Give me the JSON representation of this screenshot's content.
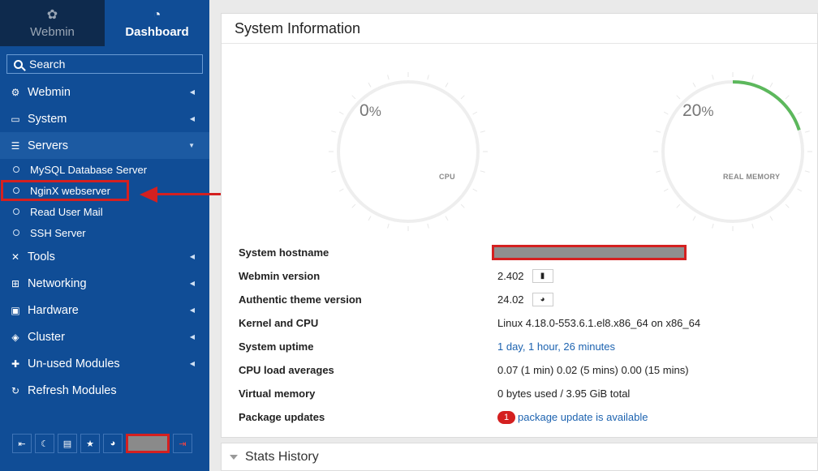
{
  "sidebar": {
    "tabs": [
      {
        "label": "Webmin",
        "icon": "webmin-logo-icon"
      },
      {
        "label": "Dashboard",
        "icon": "dashboard-gauge-icon"
      }
    ],
    "search_label": "Search",
    "menu": [
      {
        "label": "Webmin",
        "icon": "gear-icon"
      },
      {
        "label": "System",
        "icon": "laptop-icon"
      },
      {
        "label": "Servers",
        "icon": "server-icon"
      },
      {
        "label": "Tools",
        "icon": "tools-icon"
      },
      {
        "label": "Networking",
        "icon": "network-icon"
      },
      {
        "label": "Hardware",
        "icon": "hdd-icon"
      },
      {
        "label": "Cluster",
        "icon": "layers-icon"
      },
      {
        "label": "Un-used Modules",
        "icon": "puzzle-icon"
      },
      {
        "label": "Refresh Modules",
        "icon": "refresh-icon"
      }
    ],
    "servers_sub": [
      {
        "label": "MySQL Database Server"
      },
      {
        "label": "NginX webserver"
      },
      {
        "label": "Read User Mail"
      },
      {
        "label": "SSH Server"
      }
    ]
  },
  "panel": {
    "title": "System Information",
    "cpu": {
      "value": "0",
      "unit": "%",
      "label": "CPU",
      "fraction": 0
    },
    "memory": {
      "value": "20",
      "unit": "%",
      "label": "REAL MEMORY",
      "fraction": 0.2
    },
    "info": [
      {
        "key": "System hostname",
        "value": ""
      },
      {
        "key": "Webmin version",
        "value": "2.402"
      },
      {
        "key": "Authentic theme version",
        "value": "24.02"
      },
      {
        "key": "Kernel and CPU",
        "value": "Linux 4.18.0-553.6.1.el8.x86_64 on x86_64"
      },
      {
        "key": "System uptime",
        "value": "1 day, 1 hour, 26 minutes"
      },
      {
        "key": "CPU load averages",
        "value": "0.07 (1 min) 0.02 (5 mins) 0.00 (15 mins)"
      },
      {
        "key": "Virtual memory",
        "value": "0 bytes used / 3.95 GiB total"
      },
      {
        "key": "Package updates",
        "value": "package update is available",
        "badge": "1"
      }
    ]
  },
  "stats_title": "Stats History",
  "colors": {
    "sidebar": "#104d96",
    "accent_red": "#d42020",
    "gauge_green": "#5cb85c",
    "link": "#1d63b0"
  }
}
